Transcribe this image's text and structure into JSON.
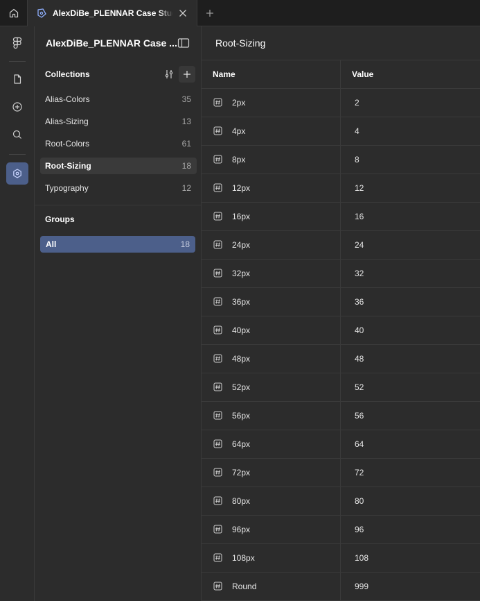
{
  "tabbar": {
    "file_tab_title": "AlexDiBe_PLENNAR Case Study f"
  },
  "panel": {
    "title": "AlexDiBe_PLENNAR Case ...",
    "collections_heading": "Collections",
    "collections": [
      {
        "label": "Alias-Colors",
        "count": "35"
      },
      {
        "label": "Alias-Sizing",
        "count": "13"
      },
      {
        "label": "Root-Colors",
        "count": "61"
      },
      {
        "label": "Root-Sizing",
        "count": "18",
        "selected": true
      },
      {
        "label": "Typography",
        "count": "12"
      }
    ],
    "groups_heading": "Groups",
    "groups": [
      {
        "label": "All",
        "count": "18"
      }
    ]
  },
  "main": {
    "title": "Root-Sizing",
    "columns": {
      "name": "Name",
      "value": "Value"
    },
    "rows": [
      {
        "name": "2px",
        "value": "2"
      },
      {
        "name": "4px",
        "value": "4"
      },
      {
        "name": "8px",
        "value": "8"
      },
      {
        "name": "12px",
        "value": "12"
      },
      {
        "name": "16px",
        "value": "16"
      },
      {
        "name": "24px",
        "value": "24"
      },
      {
        "name": "32px",
        "value": "32"
      },
      {
        "name": "36px",
        "value": "36"
      },
      {
        "name": "40px",
        "value": "40"
      },
      {
        "name": "48px",
        "value": "48"
      },
      {
        "name": "52px",
        "value": "52"
      },
      {
        "name": "56px",
        "value": "56"
      },
      {
        "name": "64px",
        "value": "64"
      },
      {
        "name": "72px",
        "value": "72"
      },
      {
        "name": "80px",
        "value": "80"
      },
      {
        "name": "96px",
        "value": "96"
      },
      {
        "name": "108px",
        "value": "108"
      },
      {
        "name": "Round",
        "value": "999"
      }
    ]
  },
  "icons": {
    "tabbar": [
      "home-icon",
      "file-icon",
      "close-icon",
      "plus-icon"
    ],
    "rail": [
      "figma-logo-icon",
      "file-icon",
      "add-circle-icon",
      "search-icon",
      "variables-icon"
    ],
    "panel": [
      "sidebar-toggle-icon",
      "settings-sliders-icon",
      "plus-icon"
    ],
    "rows": "number-variable-icon"
  },
  "colors": {
    "background": "#2c2c2c",
    "tabbar_background": "#1e1e1e",
    "selection_accent": "#4c5f8a",
    "border": "#3a3a3a"
  }
}
